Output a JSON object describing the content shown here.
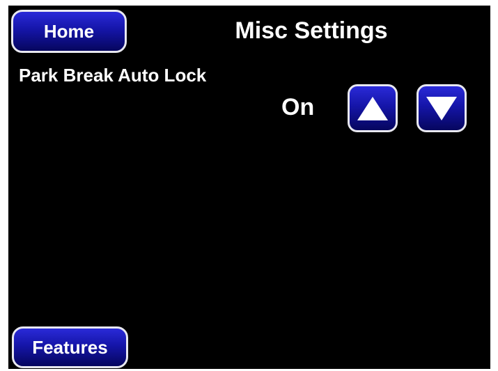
{
  "header": {
    "home_label": "Home",
    "title": "Misc Settings"
  },
  "settings": [
    {
      "label": "Park Break Auto Lock",
      "value": "On"
    }
  ],
  "controls": {
    "up_icon": "triangle-up-icon",
    "down_icon": "triangle-down-icon"
  },
  "footer": {
    "features_label": "Features"
  },
  "colors": {
    "background": "#000000",
    "button_top": "#2a2ad8",
    "button_bottom": "#06065e",
    "button_border": "#e8e8f0",
    "text": "#ffffff"
  }
}
